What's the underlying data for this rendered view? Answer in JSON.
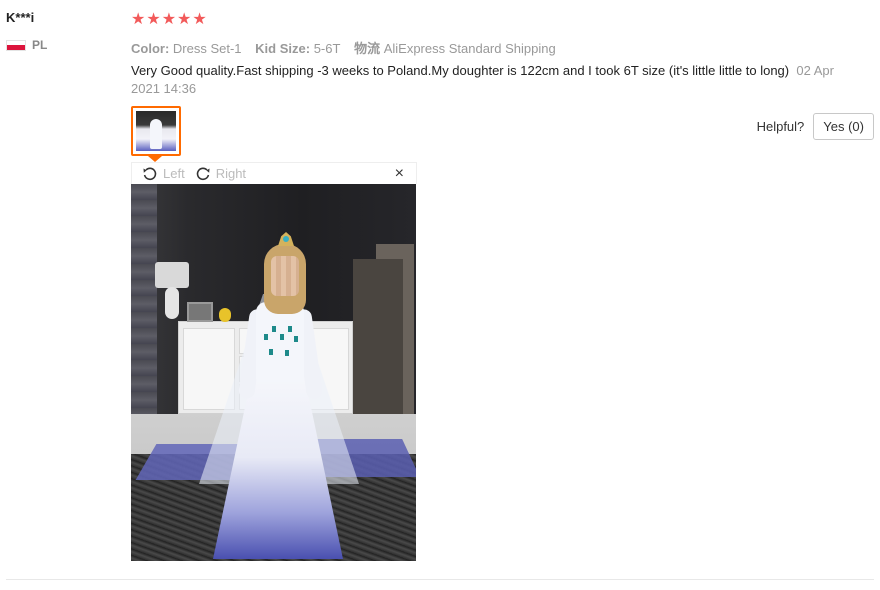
{
  "user": {
    "name": "K***i",
    "country_code": "PL"
  },
  "review": {
    "stars": [
      "★",
      "★",
      "★",
      "★",
      "★"
    ],
    "rating": 5,
    "star_color": "#f25a5a",
    "attributes": [
      {
        "key": "Color:",
        "value": "Dress Set-1"
      },
      {
        "key": "Kid Size:",
        "value": "5-6T"
      },
      {
        "key": "物流",
        "value": "AliExpress Standard Shipping"
      }
    ],
    "text": "Very Good quality.Fast shipping -3 weeks to Poland.My doughter is 122cm and I took 6T size (it's little little to long)",
    "date": "02 Apr 2021 14:36"
  },
  "helpful": {
    "label": "Helpful?",
    "yes_label": "Yes (0)"
  },
  "viewer": {
    "rotate_left_label": "Left",
    "rotate_right_label": "Right",
    "close_glyph": "×"
  },
  "colors": {
    "accent": "#ff6a00",
    "muted_text": "#999999"
  }
}
